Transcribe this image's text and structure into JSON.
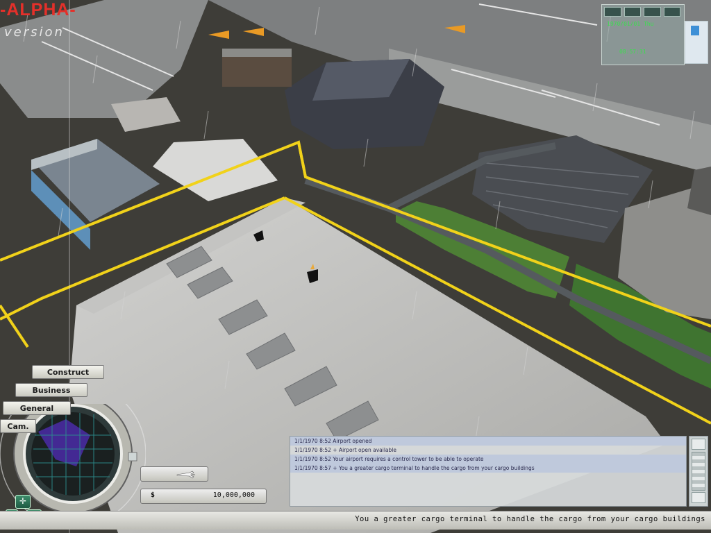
{
  "branding": {
    "alpha": "-ALPHA-",
    "version": "version"
  },
  "top_right": {
    "date": "1970/01/01 Thu",
    "time": "08:57:31"
  },
  "menu": {
    "construct": "Construct",
    "business": "Business",
    "general": "General",
    "cam": "Cam."
  },
  "finance": {
    "currency_symbol": "$",
    "money": "10,000,000"
  },
  "messages": [
    {
      "text": "1/1/1970 8:52  Airport opened",
      "highlight": true
    },
    {
      "text": "1/1/1970 8:52  + Airport open available",
      "highlight": false
    },
    {
      "text": "1/1/1970 8:52  Your airport requires a control tower to be able to operate",
      "highlight": true
    },
    {
      "text": "1/1/1970 8:57  + You a greater cargo terminal to handle the cargo from your cargo buildings",
      "highlight": true
    }
  ],
  "status_text": "You a greater cargo terminal to handle the cargo from your cargo buildings",
  "colors": {
    "brand_red": "#e4302a",
    "highlight_yellow": "#f1d21a",
    "clock_green": "#39e04c"
  },
  "icons": {
    "move": "cross-arrows-icon",
    "rotate": "rotate-icon",
    "plane": "airplane-icon"
  }
}
